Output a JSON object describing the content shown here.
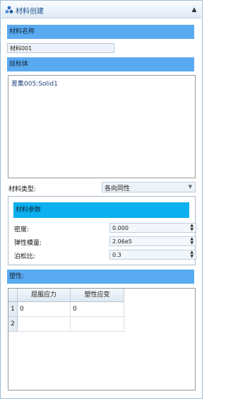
{
  "titlebar": {
    "title": "材料创建",
    "collapse_icon": "chevron-up-icon"
  },
  "material_name": {
    "header": "材料名称",
    "value": "材料001"
  },
  "target_body": {
    "header": "目标体",
    "items": [
      "差集005:Solid1"
    ]
  },
  "material_type": {
    "label": "材料类型:",
    "value": "各向同性"
  },
  "material_params": {
    "header": "材料参数",
    "fields": [
      {
        "label": "密度:",
        "value": "0.000"
      },
      {
        "label": "弹性模量:",
        "value": "2.06e5"
      },
      {
        "label": "泊松比:",
        "value": "0.3"
      }
    ]
  },
  "plasticity": {
    "header": "塑性:",
    "columns": [
      "屈服应力",
      "塑性应变"
    ],
    "rows": [
      {
        "index": "1",
        "cells": [
          "0",
          "0"
        ]
      },
      {
        "index": "2",
        "cells": [
          "",
          ""
        ]
      }
    ]
  },
  "colors": {
    "section_bar": "#5aaaf2",
    "group_bar": "#0ab0f0",
    "title_text": "#1a4f8a"
  }
}
